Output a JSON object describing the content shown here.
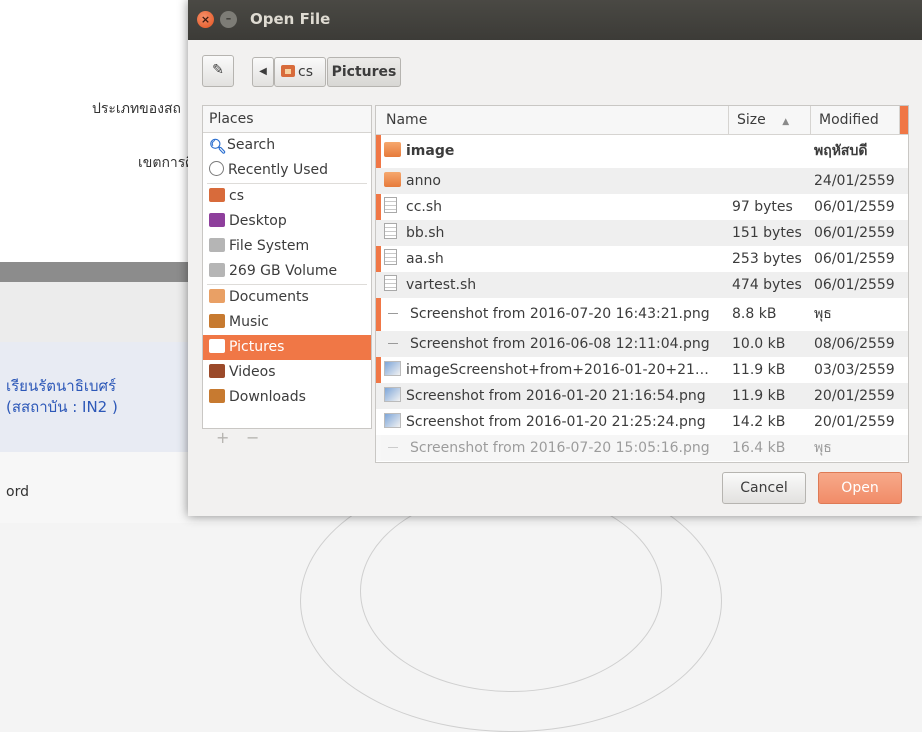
{
  "background": {
    "label_type": "ประเภทของสถ",
    "label_area": "เขตการศึ",
    "org_line1": "เรียนรัตนาธิเบศร์",
    "org_line2": "(สสถาบัน : IN2 )",
    "footer_text": "ord"
  },
  "dialog": {
    "title": "Open File",
    "close_glyph": "×",
    "min_glyph": "–",
    "edit_glyph": "✎",
    "nav_left_glyph": "◀",
    "breadcrumb": [
      "cs",
      "Pictures"
    ],
    "places_header": "Places",
    "places": [
      {
        "label": "Search",
        "icon": "search-icon",
        "color": "#2b6fd0"
      },
      {
        "label": "Recently Used",
        "icon": "clock-icon",
        "color": "#7a7a7a"
      },
      {
        "label": "cs",
        "icon": "home-folder-icon",
        "color": "#d86b3b"
      },
      {
        "label": "Desktop",
        "icon": "desktop-icon",
        "color": "#8e3f9c"
      },
      {
        "label": "File System",
        "icon": "drive-icon",
        "color": "#9a9a9a"
      },
      {
        "label": "269 GB Volume",
        "icon": "drive-icon",
        "color": "#9a9a9a"
      },
      {
        "label": "Documents",
        "icon": "documents-folder-icon",
        "color": "#e9a065"
      },
      {
        "label": "Music",
        "icon": "music-folder-icon",
        "color": "#c77a30"
      },
      {
        "label": "Pictures",
        "icon": "pictures-folder-icon",
        "color": "#ffffff"
      },
      {
        "label": "Videos",
        "icon": "videos-folder-icon",
        "color": "#9b4a2a"
      },
      {
        "label": "Downloads",
        "icon": "downloads-folder-icon",
        "color": "#c77a30"
      }
    ],
    "add_label": "+",
    "remove_label": "−",
    "columns": {
      "name": "Name",
      "size": "Size",
      "sort": "▲",
      "modified": "Modified"
    },
    "files": [
      {
        "name": "image",
        "size": "",
        "modified": "พฤหัสบดี",
        "type": "folder",
        "bold": true
      },
      {
        "name": "anno",
        "size": "",
        "modified": "24/01/2559",
        "type": "folder"
      },
      {
        "name": "cc.sh",
        "size": "97 bytes",
        "modified": "06/01/2559",
        "type": "doc"
      },
      {
        "name": "bb.sh",
        "size": "151 bytes",
        "modified": "06/01/2559",
        "type": "doc"
      },
      {
        "name": "aa.sh",
        "size": "253 bytes",
        "modified": "06/01/2559",
        "type": "doc"
      },
      {
        "name": "vartest.sh",
        "size": "474 bytes",
        "modified": "06/01/2559",
        "type": "doc"
      },
      {
        "name": "Screenshot from 2016-07-20 16:43:21.png",
        "size": "8.8 kB",
        "modified": "พุธ",
        "type": "thumb"
      },
      {
        "name": "Screenshot from 2016-06-08 12:11:04.png",
        "size": "10.0 kB",
        "modified": "08/06/2559",
        "type": "thumb"
      },
      {
        "name": "imageScreenshot+from+2016-01-20+21…",
        "size": "11.9 kB",
        "modified": "03/03/2559",
        "type": "img"
      },
      {
        "name": "Screenshot from 2016-01-20 21:16:54.png",
        "size": "11.9 kB",
        "modified": "20/01/2559",
        "type": "img"
      },
      {
        "name": "Screenshot from 2016-01-20 21:25:24.png",
        "size": "14.2 kB",
        "modified": "20/01/2559",
        "type": "img"
      },
      {
        "name": "Screenshot from 2016-07-20 15:05:16.png",
        "size": "16.4 kB",
        "modified": "พุธ",
        "type": "thumb"
      }
    ],
    "cancel_label": "Cancel",
    "open_label": "Open",
    "accent": "#f07746"
  }
}
